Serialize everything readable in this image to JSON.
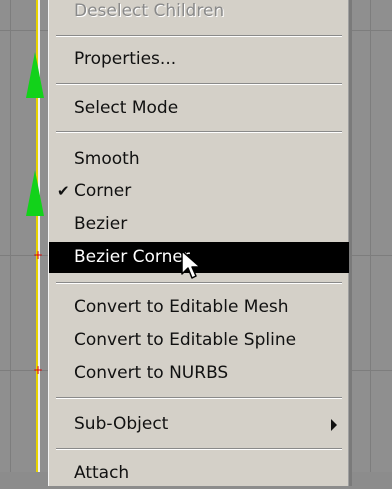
{
  "menu": {
    "items": [
      {
        "label": "Deselect Children",
        "enabled": false,
        "checked": false,
        "submenu": false
      },
      {
        "label": "Properties...",
        "enabled": true,
        "checked": false,
        "submenu": false
      },
      {
        "label": "Select Mode",
        "enabled": true,
        "checked": false,
        "submenu": false
      },
      {
        "label": "Smooth",
        "enabled": true,
        "checked": false,
        "submenu": false
      },
      {
        "label": "Corner",
        "enabled": true,
        "checked": true,
        "submenu": false
      },
      {
        "label": "Bezier",
        "enabled": true,
        "checked": false,
        "submenu": false
      },
      {
        "label": "Bezier Corner",
        "enabled": true,
        "checked": false,
        "submenu": false,
        "highlighted": true
      },
      {
        "label": "Convert to Editable Mesh",
        "enabled": true,
        "checked": false,
        "submenu": false
      },
      {
        "label": "Convert to Editable Spline",
        "enabled": true,
        "checked": false,
        "submenu": false
      },
      {
        "label": "Convert to NURBS",
        "enabled": true,
        "checked": false,
        "submenu": false
      },
      {
        "label": "Sub-Object",
        "enabled": true,
        "checked": false,
        "submenu": true
      },
      {
        "label": "Attach",
        "enabled": true,
        "checked": false,
        "submenu": false
      }
    ],
    "check_glyph": "✔"
  },
  "icons": {
    "check": "checkmark-icon",
    "submenu": "submenu-arrow-icon",
    "cursor": "mouse-pointer-icon",
    "tangent_handle": "tangent-handle-icon",
    "vertex": "vertex-marker-icon"
  },
  "colors": {
    "menu_bg": "#d4d0c8",
    "highlight_bg": "#000000",
    "highlight_fg": "#ffffff",
    "viewport_bg": "#8f8f8f",
    "tangent_handle": "#12d21a",
    "spline": "#e8d400"
  }
}
